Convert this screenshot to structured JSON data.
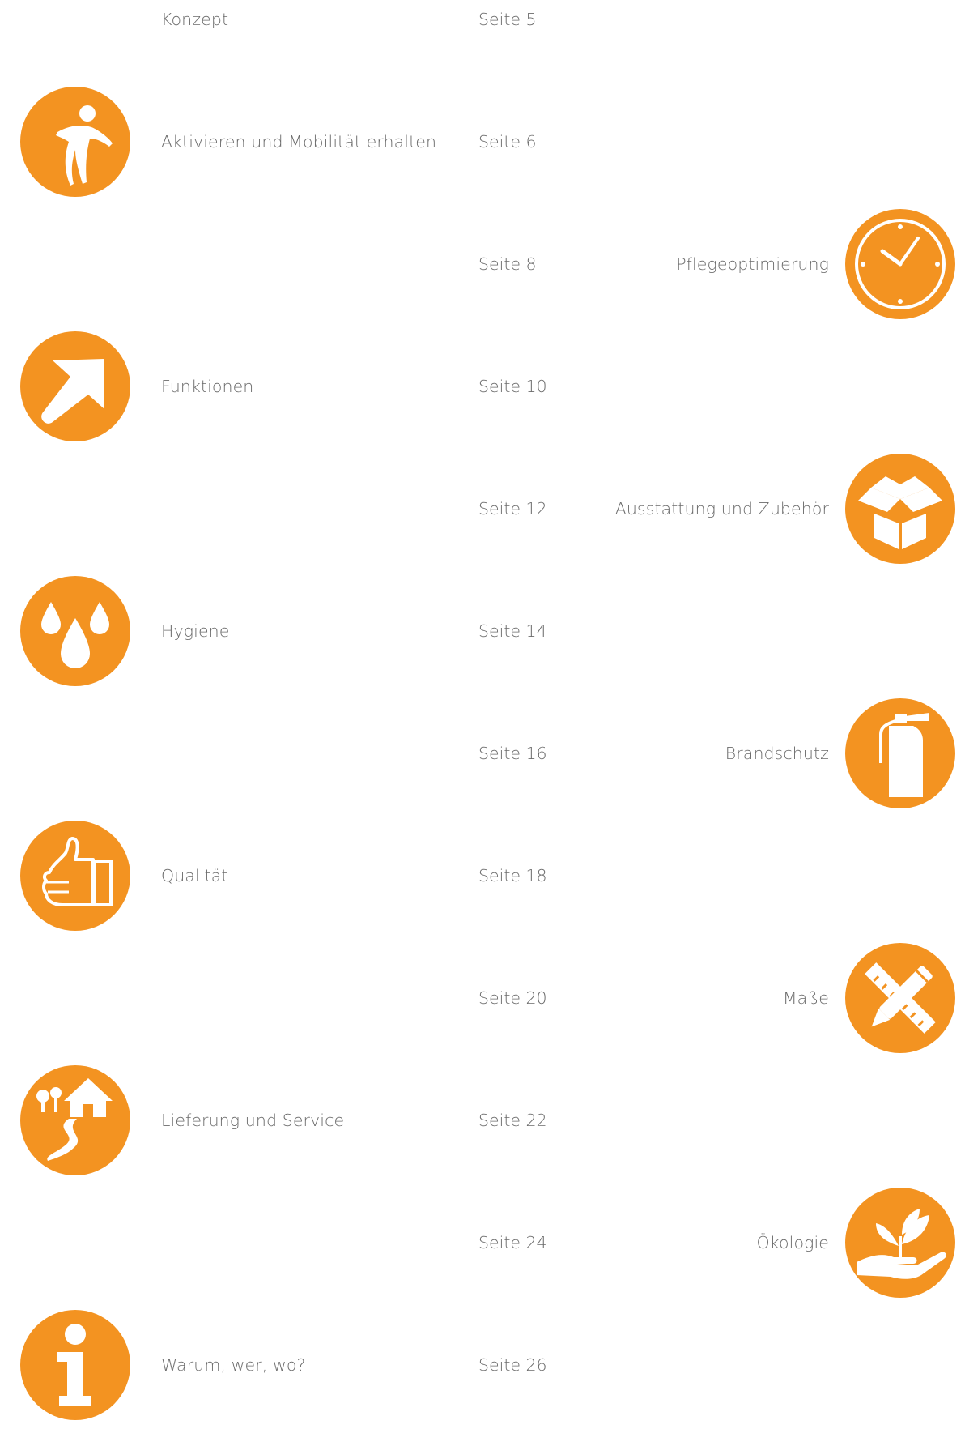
{
  "accent_color": "#F39321",
  "entries": [
    {
      "label": "Konzept",
      "page": "Seite 5",
      "side": "left",
      "icon": null
    },
    {
      "label": "Aktivieren und Mobilität erhalten",
      "page": "Seite 6",
      "side": "left",
      "icon": "running-person-icon"
    },
    {
      "label": "Pflegeoptimierung",
      "page": "Seite 8",
      "side": "right",
      "icon": "clock-icon"
    },
    {
      "label": "Funktionen",
      "page": "Seite 10",
      "side": "left",
      "icon": "arrow-up-right-icon"
    },
    {
      "label": "Ausstattung und Zubehör",
      "page": "Seite 12",
      "side": "right",
      "icon": "box-icon"
    },
    {
      "label": "Hygiene",
      "page": "Seite 14",
      "side": "left",
      "icon": "water-drops-icon"
    },
    {
      "label": "Brandschutz",
      "page": "Seite 16",
      "side": "right",
      "icon": "fire-extinguisher-icon"
    },
    {
      "label": "Qualität",
      "page": "Seite 18",
      "side": "left",
      "icon": "thumbs-up-icon"
    },
    {
      "label": "Maße",
      "page": "Seite 20",
      "side": "right",
      "icon": "ruler-pencil-icon"
    },
    {
      "label": "Lieferung und Service",
      "page": "Seite 22",
      "side": "left",
      "icon": "house-road-icon"
    },
    {
      "label": "Ökologie",
      "page": "Seite 24",
      "side": "right",
      "icon": "plant-hand-icon"
    },
    {
      "label": "Warum, wer, wo?",
      "page": "Seite 26",
      "side": "left",
      "icon": "info-icon"
    }
  ]
}
